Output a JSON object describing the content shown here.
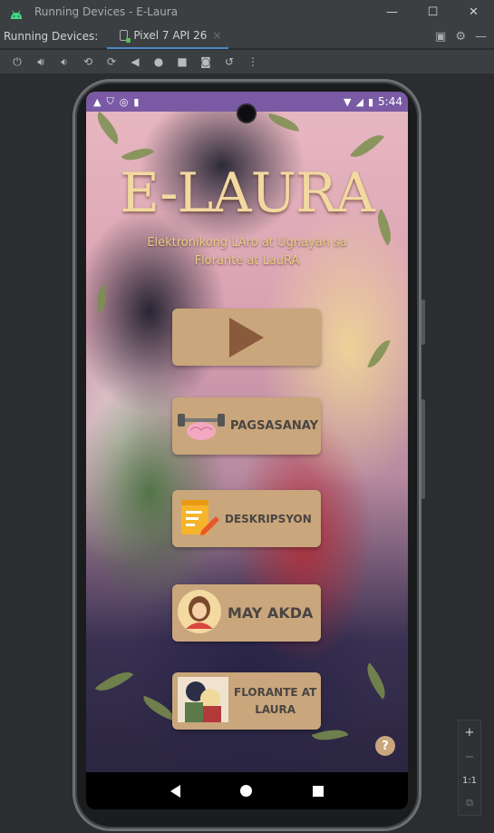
{
  "window": {
    "title": "Running Devices - E-Laura",
    "minimize": "—",
    "maximize": "☐",
    "close": "✕"
  },
  "tabs": {
    "label": "Running Devices:",
    "device_tab": "Pixel 7 API 26",
    "close": "×"
  },
  "status": {
    "time": "5:44"
  },
  "app": {
    "logo": "E-LAURA",
    "subtitle_line1": "Elektronikong LAro at Ugnayan sa",
    "subtitle_line2": "Florante at LauRA",
    "buttons": {
      "pagsasanay": "PAGSASANAY",
      "deskripsyon": "DESKRIPSYON",
      "may_akda": "MAY AKDA",
      "florante_line1": "FLORANTE AT",
      "florante_line2": "LAURA"
    },
    "help": "?"
  },
  "zoom": {
    "plus": "+",
    "minus": "−",
    "one_to_one": "1:1"
  },
  "colors": {
    "ide_bg": "#2b2d30",
    "status_bar": "#7a5aa4",
    "button_bg": "#c9a67c",
    "logo": "#f2d9a0",
    "tab_accent": "#4a88c7"
  }
}
